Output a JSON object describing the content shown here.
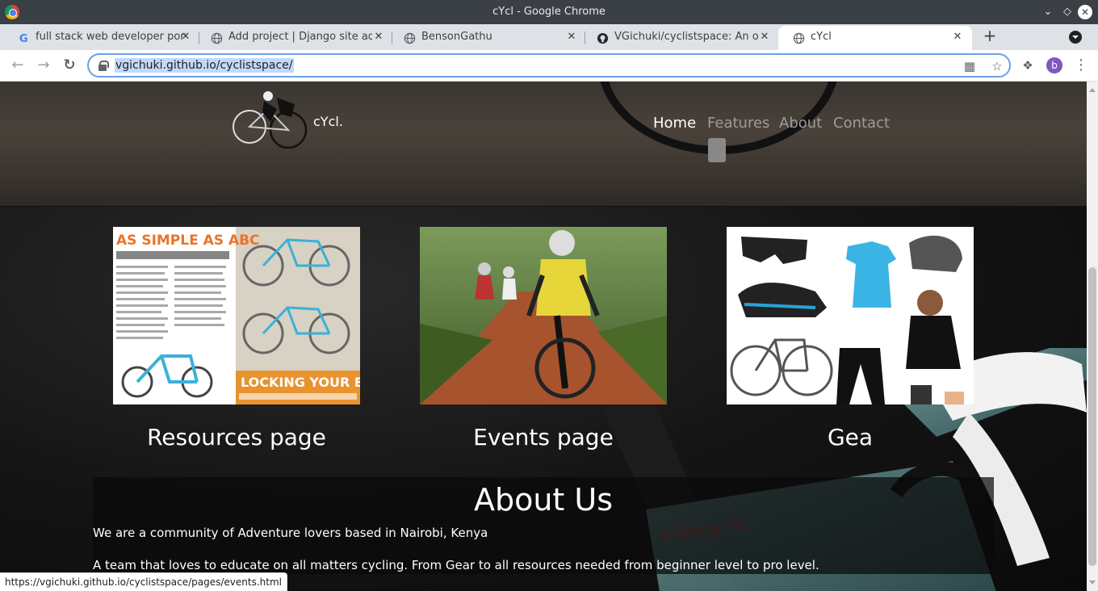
{
  "window": {
    "title": "cYcl - Google Chrome"
  },
  "tabs": [
    {
      "title": "full stack web developer portf",
      "icon": "google-icon"
    },
    {
      "title": "Add project | Django site admi",
      "icon": "globe-icon"
    },
    {
      "title": "BensonGathu",
      "icon": "globe-icon"
    },
    {
      "title": "VGichuki/cyclistspace: An onli",
      "icon": "github-icon"
    },
    {
      "title": "cYcl",
      "icon": "globe-icon",
      "active": true
    }
  ],
  "omnibox": {
    "url": "vgichuki.github.io/cyclistspace/"
  },
  "profile": {
    "initial": "b",
    "color": "#7e57c2"
  },
  "site": {
    "brand": "cYcl.",
    "nav": [
      "Home",
      "Features",
      "About",
      "Contact"
    ],
    "cards": [
      {
        "title": "Resources page",
        "image": "bike-maintenance-infographic"
      },
      {
        "title": "Events page",
        "image": "cyclists-on-dirt-road"
      },
      {
        "title": "Gea",
        "image": "cycling-gear-collage"
      }
    ],
    "about": {
      "title": "About Us",
      "p1": "We are a community of Adventure lovers based in Nairobi, Kenya",
      "p2": "A team that loves to educate on all matters cycling. From Gear to all resources needed from beginner level to pro level."
    }
  },
  "infographic": {
    "title": "AS SIMPLE AS ABC",
    "banner": "LOCKING YOUR BIKE",
    "subtitle": "THE ABC QUICK CHECK WILL ENSURE YOUR BIKE IS IN GOOD WORKING ORDER AND MAKE YOUR RIDE SAFER.",
    "lock_text": "TO LOCK YOUR BIKE, USE A U-SHAPED LOCK, A HEAVY STEEL CABLE LOCK OR A COMBINATION OF THE TWO. SECURE BOTH"
  },
  "statusbar": {
    "text": "https://vgichuki.github.io/cyclistspace/pages/events.html"
  },
  "colors": {
    "accent": "#1a73e8",
    "link_hover_blue": "#c3d9f9",
    "page_bg": "#0a0a0a"
  }
}
